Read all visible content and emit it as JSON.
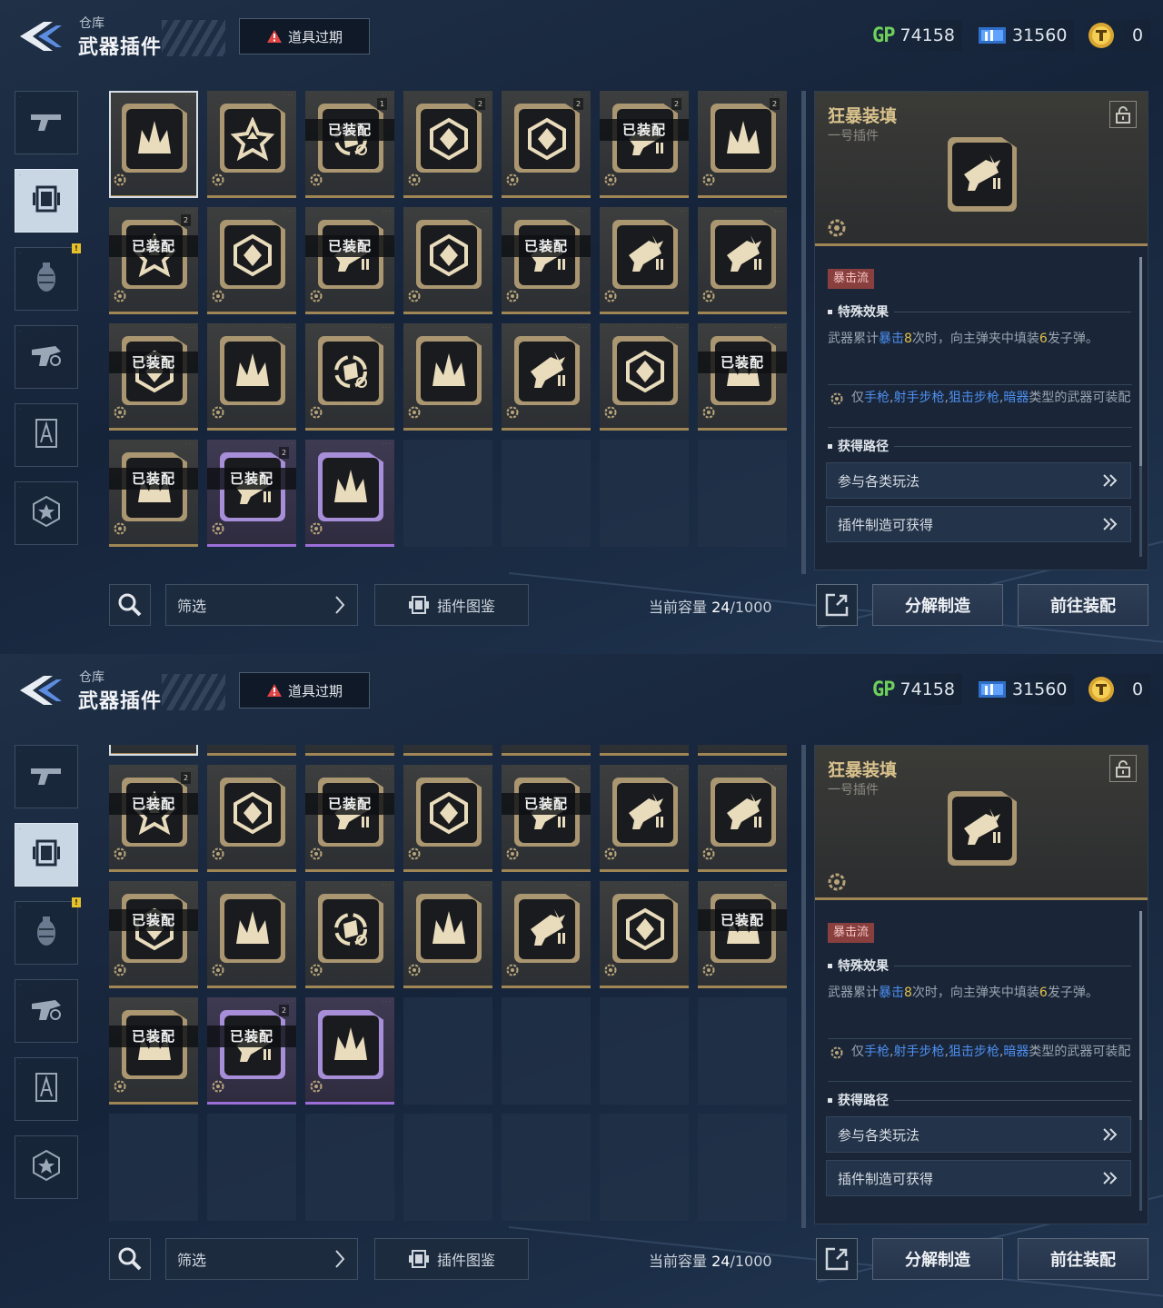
{
  "header": {
    "subtitle": "仓库",
    "title": "武器插件",
    "expire_label": "道具过期"
  },
  "currency": {
    "gp_label": "GP",
    "gp_value": "74158",
    "ticket_value": "31560",
    "coin_value": "0"
  },
  "sidebar": {
    "items": [
      {
        "icon": "pistol-icon"
      },
      {
        "icon": "plugin-icon",
        "active": true
      },
      {
        "icon": "grenade-icon",
        "alert": "!"
      },
      {
        "icon": "weapon-parts-icon"
      },
      {
        "icon": "compass-icon"
      },
      {
        "icon": "star-badge-icon"
      }
    ]
  },
  "grid": {
    "equipped_label": "已装配",
    "cells": [
      {
        "icon": "pistol-burst-icon",
        "equipped": false,
        "rarity": "gold",
        "selected": true
      },
      {
        "icon": "reload-cycle-icon",
        "equipped": false,
        "rarity": "gold"
      },
      {
        "icon": "split-arrow-icon",
        "equipped": true,
        "rarity": "gold",
        "count": "1"
      },
      {
        "icon": "crown-spike-icon",
        "equipped": false,
        "rarity": "gold",
        "count": "2"
      },
      {
        "icon": "crown-spike-icon",
        "equipped": false,
        "rarity": "gold",
        "count": "2"
      },
      {
        "icon": "cycle-target-icon",
        "equipped": true,
        "rarity": "gold",
        "count": "2"
      },
      {
        "icon": "diamond-shard-icon",
        "equipped": false,
        "rarity": "gold",
        "count": "2"
      },
      {
        "icon": "rune-star-icon",
        "equipped": true,
        "rarity": "gold",
        "count": "2"
      },
      {
        "icon": "lightning-up-icon",
        "equipped": false,
        "rarity": "gold"
      },
      {
        "icon": "spike-burst-icon",
        "equipped": true,
        "rarity": "gold"
      },
      {
        "icon": "shatter-icon",
        "equipped": false,
        "rarity": "gold"
      },
      {
        "icon": "triangle-crack-icon",
        "equipped": true,
        "rarity": "gold"
      },
      {
        "icon": "hex-core-icon",
        "equipped": false,
        "rarity": "gold"
      },
      {
        "icon": "star-shield-icon",
        "equipped": false,
        "rarity": "gold"
      },
      {
        "icon": "hex-frame-icon",
        "equipped": true,
        "rarity": "gold"
      },
      {
        "icon": "spiral-shot-icon",
        "equipped": false,
        "rarity": "gold"
      },
      {
        "icon": "bolt-shield-icon",
        "equipped": false,
        "rarity": "gold"
      },
      {
        "icon": "bullet-up-icon",
        "equipped": false,
        "rarity": "gold"
      },
      {
        "icon": "flower-shard-icon",
        "equipped": false,
        "rarity": "gold"
      },
      {
        "icon": "turret-gear-icon",
        "equipped": false,
        "rarity": "gold"
      },
      {
        "icon": "orb-slash-icon",
        "equipped": true,
        "rarity": "gold"
      },
      {
        "icon": "ring-gear-icon",
        "equipped": true,
        "rarity": "gold"
      },
      {
        "icon": "globe-lines-icon",
        "equipped": true,
        "rarity": "purple",
        "count": "2"
      },
      {
        "icon": "lightning-orb-icon",
        "equipped": false,
        "rarity": "purple"
      }
    ]
  },
  "detail": {
    "name": "狂暴装填",
    "slot": "一号插件",
    "tag": "暴击流",
    "effect_heading": "特殊效果",
    "effect_parts": [
      "武器累计",
      "暴击",
      "8",
      "次时，向主弹夹中填装",
      "6",
      "发子弹。"
    ],
    "restrict_parts": [
      "仅",
      "手枪",
      ",",
      "射手步枪",
      ",",
      "狙击步枪",
      ",",
      "暗器",
      "类型的武器可装配"
    ],
    "source_heading": "获得路径",
    "routes": [
      "参与各类玩法",
      "插件制造可获得"
    ]
  },
  "bottom": {
    "filter_label": "筛选",
    "codex_label": "插件图鉴",
    "capacity_label": "当前容量",
    "capacity_value": "24",
    "capacity_max": "/1000",
    "dismantle_label": "分解制造",
    "equip_label": "前往装配"
  }
}
